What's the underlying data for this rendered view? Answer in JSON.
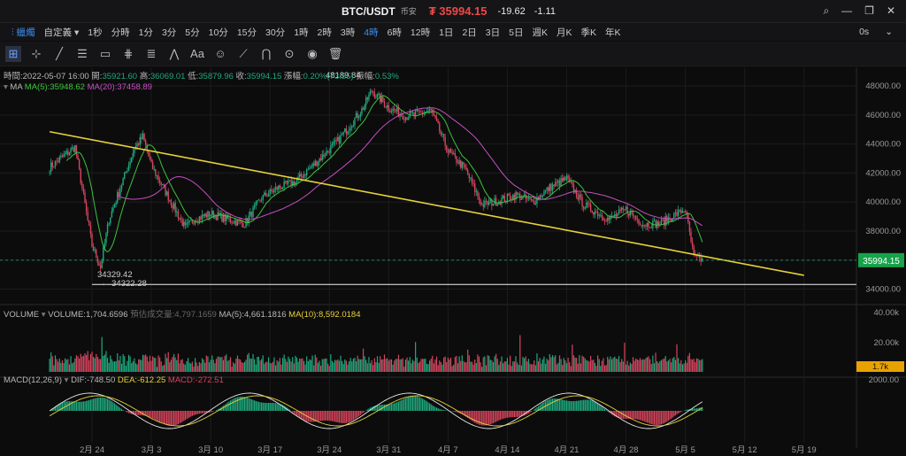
{
  "title": {
    "symbol": "BTC/USDT",
    "exchange": "币安",
    "currency": "₮",
    "price": "35994.15",
    "change": "-19.62",
    "change_pct": "-1.11"
  },
  "toolbar": {
    "chart_type": "蠟燭",
    "custom": "自定義",
    "timeframes": [
      "1秒",
      "分時",
      "1分",
      "3分",
      "5分",
      "10分",
      "15分",
      "30分",
      "1時",
      "2時",
      "3時",
      "4時",
      "6時",
      "12時",
      "1日",
      "2日",
      "3日",
      "5日",
      "週K",
      "月K",
      "季K",
      "年K"
    ],
    "active_timeframe": "4時",
    "right_label": "0s"
  },
  "ohlc_line": {
    "time_label": "時間:",
    "time": "2022-05-07 16:00",
    "open_label": "開:",
    "open": "35921.60",
    "high_label": "高:",
    "high": "36069.01",
    "low_label": "低:",
    "low": "35879.96",
    "close_label": "收:",
    "close": "35994.15",
    "change_label": "漲幅:",
    "change": "0.20%(73.55)",
    "amp_label": "振幅:",
    "amp": "0.53%"
  },
  "ma_line": {
    "name": "MA",
    "ma5": "MA(5):35948.62",
    "ma20": "MA(20):37458.89"
  },
  "vol_line": {
    "name": "VOLUME",
    "volume": "VOLUME:1,704.6596",
    "est": "預估成交量:4,797.1659",
    "ma5": "MA(5):4,661.1816",
    "ma10": "MA(10):8,592.0184"
  },
  "macd_line": {
    "name": "MACD(12,26,9)",
    "dif": "DIF:-748.50",
    "dea": "DEA:-612.25",
    "macd": "MACD:-272.51"
  },
  "colors": {
    "up": "#1fa97e",
    "down": "#d6455d",
    "ma5": "#3cc43c",
    "ma20": "#c64fc0",
    "trend": "#e6d23a",
    "support": "#f0f0f0",
    "active": "#3a8ff0"
  },
  "chart_data": {
    "type": "candlestick",
    "x_tick_labels": [
      "2月 24",
      "3月 3",
      "3月 10",
      "3月 17",
      "3月 24",
      "3月 31",
      "4月 7",
      "4月 14",
      "4月 21",
      "4月 28",
      "5月 5",
      "5月 12",
      "5月 19"
    ],
    "price_axis": [
      34000,
      36000,
      38000,
      40000,
      42000,
      44000,
      46000,
      48000
    ],
    "price_axis_labels": [
      "34000.00",
      "36000.00",
      "38000.00",
      "40000.00",
      "42000.00",
      "44000.00",
      "46000.00",
      "48000.00"
    ],
    "ylim": [
      33300,
      48800
    ],
    "current_price": "35994.15",
    "annotations": {
      "high": "48189.84",
      "low": "34329.42",
      "low_line": "34322.28",
      "low_line_value": 34322.28
    },
    "trendline": {
      "start": [
        "2022-02-19",
        44850
      ],
      "end": [
        "2022-05-19",
        34950
      ]
    },
    "price_path": [
      [
        "2022-02-19",
        42400
      ],
      [
        "2022-02-22",
        43800
      ],
      [
        "2022-02-24",
        37000
      ],
      [
        "2022-02-25",
        35500
      ],
      [
        "2022-02-26",
        38800
      ],
      [
        "2022-03-01",
        43700
      ],
      [
        "2022-03-02",
        44500
      ],
      [
        "2022-03-03",
        42500
      ],
      [
        "2022-03-07",
        38200
      ],
      [
        "2022-03-08",
        38800
      ],
      [
        "2022-03-10",
        39200
      ],
      [
        "2022-03-12",
        38800
      ],
      [
        "2022-03-14",
        38500
      ],
      [
        "2022-03-16",
        40300
      ],
      [
        "2022-03-18",
        41000
      ],
      [
        "2022-03-20",
        41400
      ],
      [
        "2022-03-22",
        42500
      ],
      [
        "2022-03-25",
        44200
      ],
      [
        "2022-03-28",
        46500
      ],
      [
        "2022-03-29",
        47700
      ],
      [
        "2022-03-31",
        46500
      ],
      [
        "2022-04-02",
        45900
      ],
      [
        "2022-04-05",
        46300
      ],
      [
        "2022-04-07",
        43500
      ],
      [
        "2022-04-09",
        42300
      ],
      [
        "2022-04-11",
        39800
      ],
      [
        "2022-04-13",
        40100
      ],
      [
        "2022-04-15",
        40500
      ],
      [
        "2022-04-17",
        40000
      ],
      [
        "2022-04-19",
        41000
      ],
      [
        "2022-04-21",
        41600
      ],
      [
        "2022-04-23",
        39800
      ],
      [
        "2022-04-26",
        38800
      ],
      [
        "2022-04-28",
        39500
      ],
      [
        "2022-04-30",
        38500
      ],
      [
        "2022-05-02",
        38500
      ],
      [
        "2022-05-04",
        39200
      ],
      [
        "2022-05-05",
        39500
      ],
      [
        "2022-05-06",
        36200
      ],
      [
        "2022-05-07",
        35990
      ]
    ],
    "volume_axis_labels": [
      "40.00k",
      "20.00k",
      "1.7k"
    ],
    "volume_ylim": [
      0,
      40000
    ],
    "current_volume_label": "1.7k",
    "macd_axis_labels": [
      "2000.00"
    ]
  }
}
